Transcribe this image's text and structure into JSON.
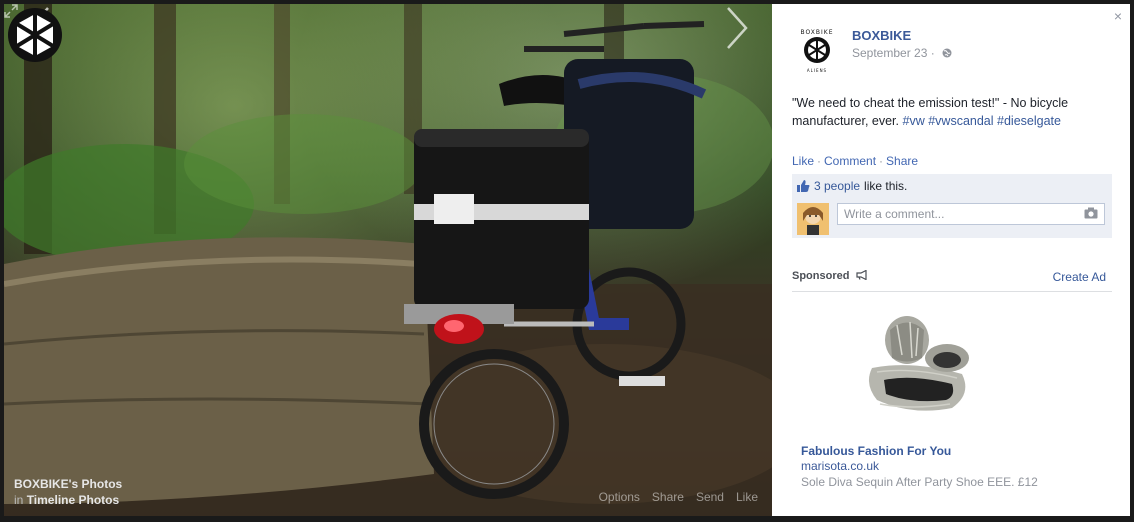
{
  "post": {
    "page_name": "BOXBIKE",
    "date": "September 23 ·",
    "text_main": "\"We need to cheat the emission test!\" - No bicycle manufacturer, ever.",
    "hashtags": [
      "#vw",
      "#vwscandal",
      "#dieselgate"
    ]
  },
  "logo": {
    "text": "BOXBIKE",
    "subtext": "ALIENS"
  },
  "actions": {
    "like": "Like",
    "comment": "Comment",
    "share": "Share",
    "separator": "·"
  },
  "likes": {
    "count_link": "3 people",
    "suffix": "like this."
  },
  "comment_box": {
    "placeholder": "Write a comment..."
  },
  "sponsored": {
    "label": "Sponsored",
    "create_ad": "Create Ad",
    "ad": {
      "title": "Fabulous Fashion For You",
      "domain": "marisota.co.uk",
      "description": "Sole Diva Sequin After Party Shoe EEE. £12"
    }
  },
  "photo_caption": {
    "album": "BOXBIKE's Photos",
    "in": "in",
    "timeline": "Timeline Photos"
  },
  "photo_actions": {
    "options": "Options",
    "share": "Share",
    "send": "Send",
    "like": "Like"
  },
  "close": "×",
  "icons": [
    "chevron-left-icon",
    "chevron-right-icon",
    "expand-icon",
    "globe-icon",
    "thumbs-up-icon",
    "camera-icon",
    "megaphone-icon",
    "close-icon"
  ],
  "colors": {
    "link": "#365899",
    "accent": "#3b5998",
    "muted": "#90949c",
    "likes_bg": "#eceff5"
  }
}
